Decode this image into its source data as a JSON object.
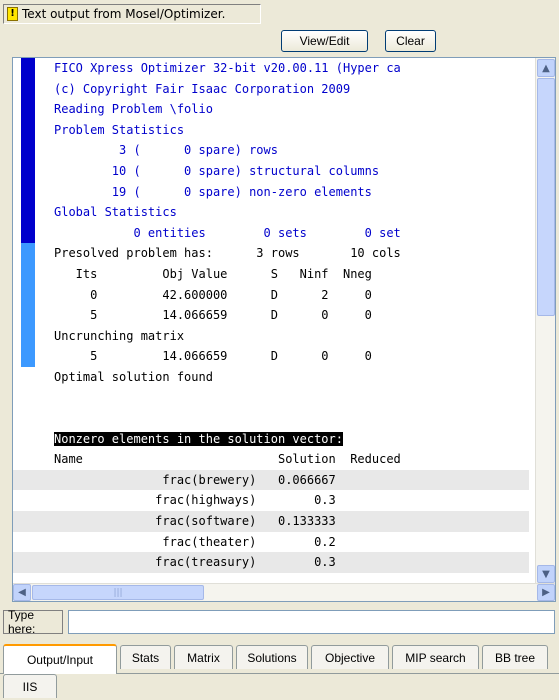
{
  "header": {
    "label": "Text output from Mosel/Optimizer.",
    "view_edit": "View/Edit",
    "clear": "Clear"
  },
  "output_lines": [
    {
      "text": "FICO Xpress Optimizer 32-bit v20.00.11 (Hyper ca",
      "style": "blue"
    },
    {
      "text": "(c) Copyright Fair Isaac Corporation 2009",
      "style": "blue"
    },
    {
      "text": "Reading Problem \\folio",
      "style": "blue"
    },
    {
      "text": "Problem Statistics",
      "style": "blue"
    },
    {
      "text": "         3 (      0 spare) rows",
      "style": "blue"
    },
    {
      "text": "        10 (      0 spare) structural columns",
      "style": "blue"
    },
    {
      "text": "        19 (      0 spare) non-zero elements",
      "style": "blue"
    },
    {
      "text": "Global Statistics",
      "style": "blue"
    },
    {
      "text": "           0 entities        0 sets        0 set",
      "style": "blue"
    },
    {
      "text": "Presolved problem has:      3 rows       10 cols",
      "style": "lightblue"
    },
    {
      "text": "   Its         Obj Value      S   Ninf  Nneg",
      "style": "lightblue"
    },
    {
      "text": "     0         42.600000      D      2     0",
      "style": "lightblue"
    },
    {
      "text": "     5         14.066659      D      0     0",
      "style": "lightblue"
    },
    {
      "text": "Uncrunching matrix",
      "style": "lightblue"
    },
    {
      "text": "     5         14.066659      D      0     0",
      "style": "lightblue"
    },
    {
      "text": "Optimal solution found",
      "style": "plain"
    },
    {
      "text": "",
      "style": "spacer"
    },
    {
      "text": "",
      "style": "spacer"
    },
    {
      "text": "Nonzero elements in the solution vector:",
      "style": "header-black"
    },
    {
      "text": "Name                           Solution  Reduced",
      "style": "plain"
    },
    {
      "text": "               frac(brewery)   0.066667",
      "style": "gray"
    },
    {
      "text": "              frac(highways)        0.3",
      "style": "plain"
    },
    {
      "text": "              frac(software)   0.133333",
      "style": "gray"
    },
    {
      "text": "               frac(theater)        0.2",
      "style": "plain"
    },
    {
      "text": "              frac(treasury)        0.3",
      "style": "gray"
    }
  ],
  "scroll": {
    "up_arrow": "▲",
    "down_arrow": "▼",
    "left_arrow": "◀",
    "right_arrow": "▶",
    "thumb_grip": "|||"
  },
  "input": {
    "label": "Type here:",
    "value": ""
  },
  "tabs": [
    {
      "label": "Output/Input",
      "active": true
    },
    {
      "label": "Stats",
      "active": false
    },
    {
      "label": "Matrix",
      "active": false
    },
    {
      "label": "Solutions",
      "active": false
    },
    {
      "label": "Objective",
      "active": false
    },
    {
      "label": "MIP search",
      "active": false
    },
    {
      "label": "BB tree",
      "active": false
    },
    {
      "label": "IIS",
      "active": false
    }
  ]
}
